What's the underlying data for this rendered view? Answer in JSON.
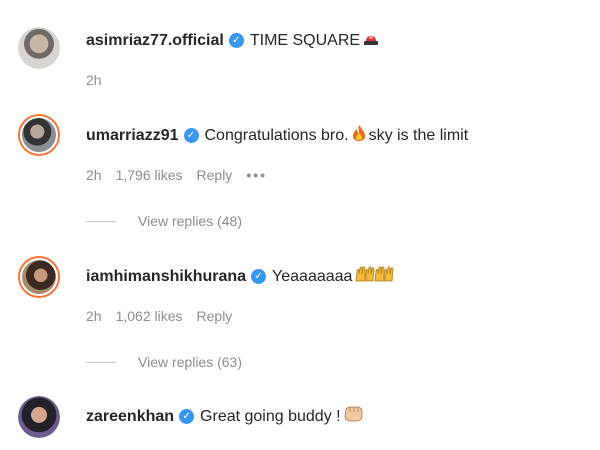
{
  "comments": [
    {
      "username": "asimriaz77.official",
      "text": "TIME SQUARE",
      "emoji": "police-light",
      "time": "2h"
    },
    {
      "username": "umarriazz91",
      "text_before": "Congratulations bro.",
      "emoji": "fire",
      "text_after": "sky is the limit",
      "time": "2h",
      "likes": "1,796 likes",
      "reply": "Reply",
      "more": "•••",
      "view_replies": "View replies (48)"
    },
    {
      "username": "iamhimanshikhurana",
      "text": "Yeaaaaaaa",
      "emoji": "raising-hands",
      "time": "2h",
      "likes": "1,062 likes",
      "reply": "Reply",
      "view_replies": "View replies (63)"
    },
    {
      "username": "zareenkhan",
      "text": "Great going buddy !",
      "emoji": "fist-bump"
    }
  ],
  "colors": {
    "verified": "#3897f0",
    "story_ring": "#d6249f",
    "muted": "#8e8e8e"
  }
}
